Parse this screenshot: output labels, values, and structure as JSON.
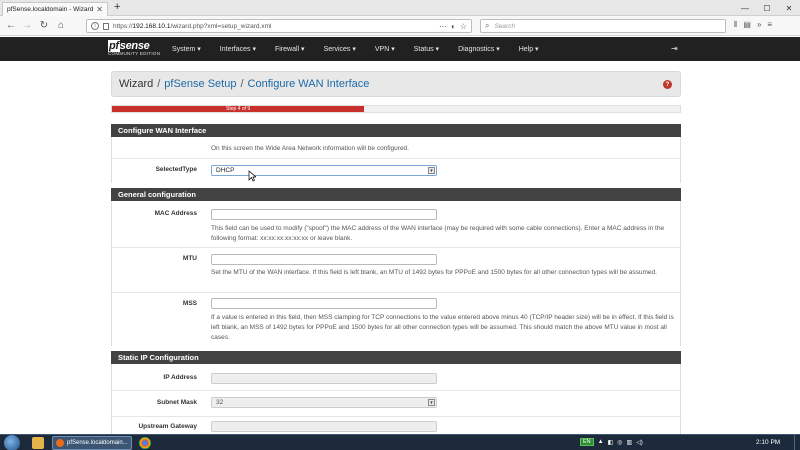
{
  "browser": {
    "tab_title": "pfSense.localdomain - Wizard: pfSe",
    "url_prefix": "https://",
    "url_host": "192.168.10.1",
    "url_path": "/wizard.php?xml=setup_wizard.xml",
    "search_placeholder": "Search",
    "win_min": "—",
    "win_max": "☐",
    "win_close": "✕"
  },
  "nav": {
    "logo_text": "sense",
    "logo_prefix": "pf",
    "edition": "COMMUNITY EDITION",
    "items": [
      {
        "label": "System ▾"
      },
      {
        "label": "Interfaces ▾"
      },
      {
        "label": "Firewall ▾"
      },
      {
        "label": "Services ▾"
      },
      {
        "label": "VPN ▾"
      },
      {
        "label": "Status ▾"
      },
      {
        "label": "Diagnostics ▾"
      },
      {
        "label": "Help ▾"
      }
    ]
  },
  "breadcrumb": {
    "root": "Wizard",
    "sep": "/",
    "level1": "pfSense Setup",
    "level2": "Configure WAN Interface",
    "help": "?"
  },
  "progress": {
    "label": "Step 4 of 9",
    "fraction": 0.444
  },
  "configure_wan": {
    "heading": "Configure WAN Interface",
    "intro": "On this screen the Wide Area Network information will be configured.",
    "selected_type_label": "SelectedType",
    "selected_type_value": "DHCP"
  },
  "general": {
    "heading": "General configuration",
    "mac_label": "MAC Address",
    "mac_help": "This field can be used to modify (\"spoof\") the MAC address of the WAN interface (may be required with some cable connections). Enter a MAC address in the following format: xx:xx:xx:xx:xx:xx or leave blank.",
    "mtu_label": "MTU",
    "mtu_help": "Set the MTU of the WAN interface. If this field is left blank, an MTU of 1492 bytes for PPPoE and 1500 bytes for all other connection types will be assumed.",
    "mss_label": "MSS",
    "mss_help": "If a value is entered in this field, then MSS clamping for TCP connections to the value entered above minus 40 (TCP/IP header size) will be in effect. If this field is left blank, an MSS of 1492 bytes for PPPoE and 1500 bytes for all other connection types will be assumed. This should match the above MTU value in most all cases."
  },
  "static_ip": {
    "heading": "Static IP Configuration",
    "ip_label": "IP Address",
    "mask_label": "Subnet Mask",
    "mask_value": "32",
    "gateway_label": "Upstream Gateway"
  },
  "taskbar": {
    "task_label": "pfSense.localdomain...",
    "kbd": "EN",
    "clock": "2:10 PM"
  },
  "colors": {
    "nav_bg": "#212121",
    "panel_head": "#424242",
    "progress": "#c9302c",
    "link": "#1e6aa6"
  }
}
